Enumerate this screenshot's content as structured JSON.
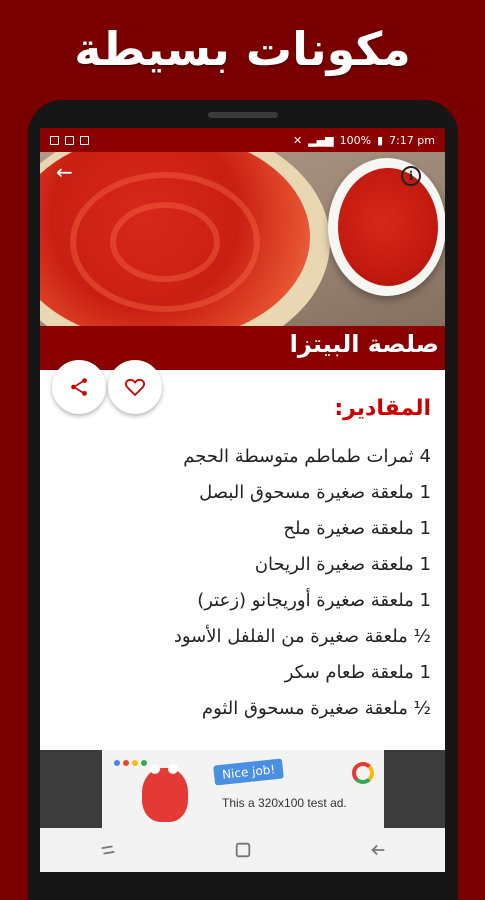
{
  "promo": {
    "title": "مكونات بسيطة"
  },
  "status_bar": {
    "battery": "100%",
    "time": "7:17 pm"
  },
  "recipe": {
    "title": "صلصة البيتزا"
  },
  "ingredients": {
    "heading": "المقادير:",
    "items": [
      "4 ثمرات طماطم متوسطة الحجم",
      "1 ملعقة صغيرة مسحوق البصل",
      "1 ملعقة صغيرة ملح",
      "1 ملعقة صغيرة الريحان",
      "1 ملعقة صغيرة أوريجانو (زعتر)",
      "½ ملعقة صغيرة من الفلفل الأسود",
      "1 ملعقة طعام سكر",
      "½ ملعقة صغيرة مسحوق الثوم"
    ]
  },
  "ad": {
    "bubble": "Nice job!",
    "text": "This a 320x100 test ad."
  },
  "colors": {
    "brand": "#8b0000",
    "heading": "#cc0000",
    "page_bg": "#7a0000"
  },
  "icons": [
    "back-arrow-icon",
    "info-icon",
    "share-icon",
    "heart-icon",
    "recents-icon",
    "home-icon",
    "back-icon"
  ]
}
